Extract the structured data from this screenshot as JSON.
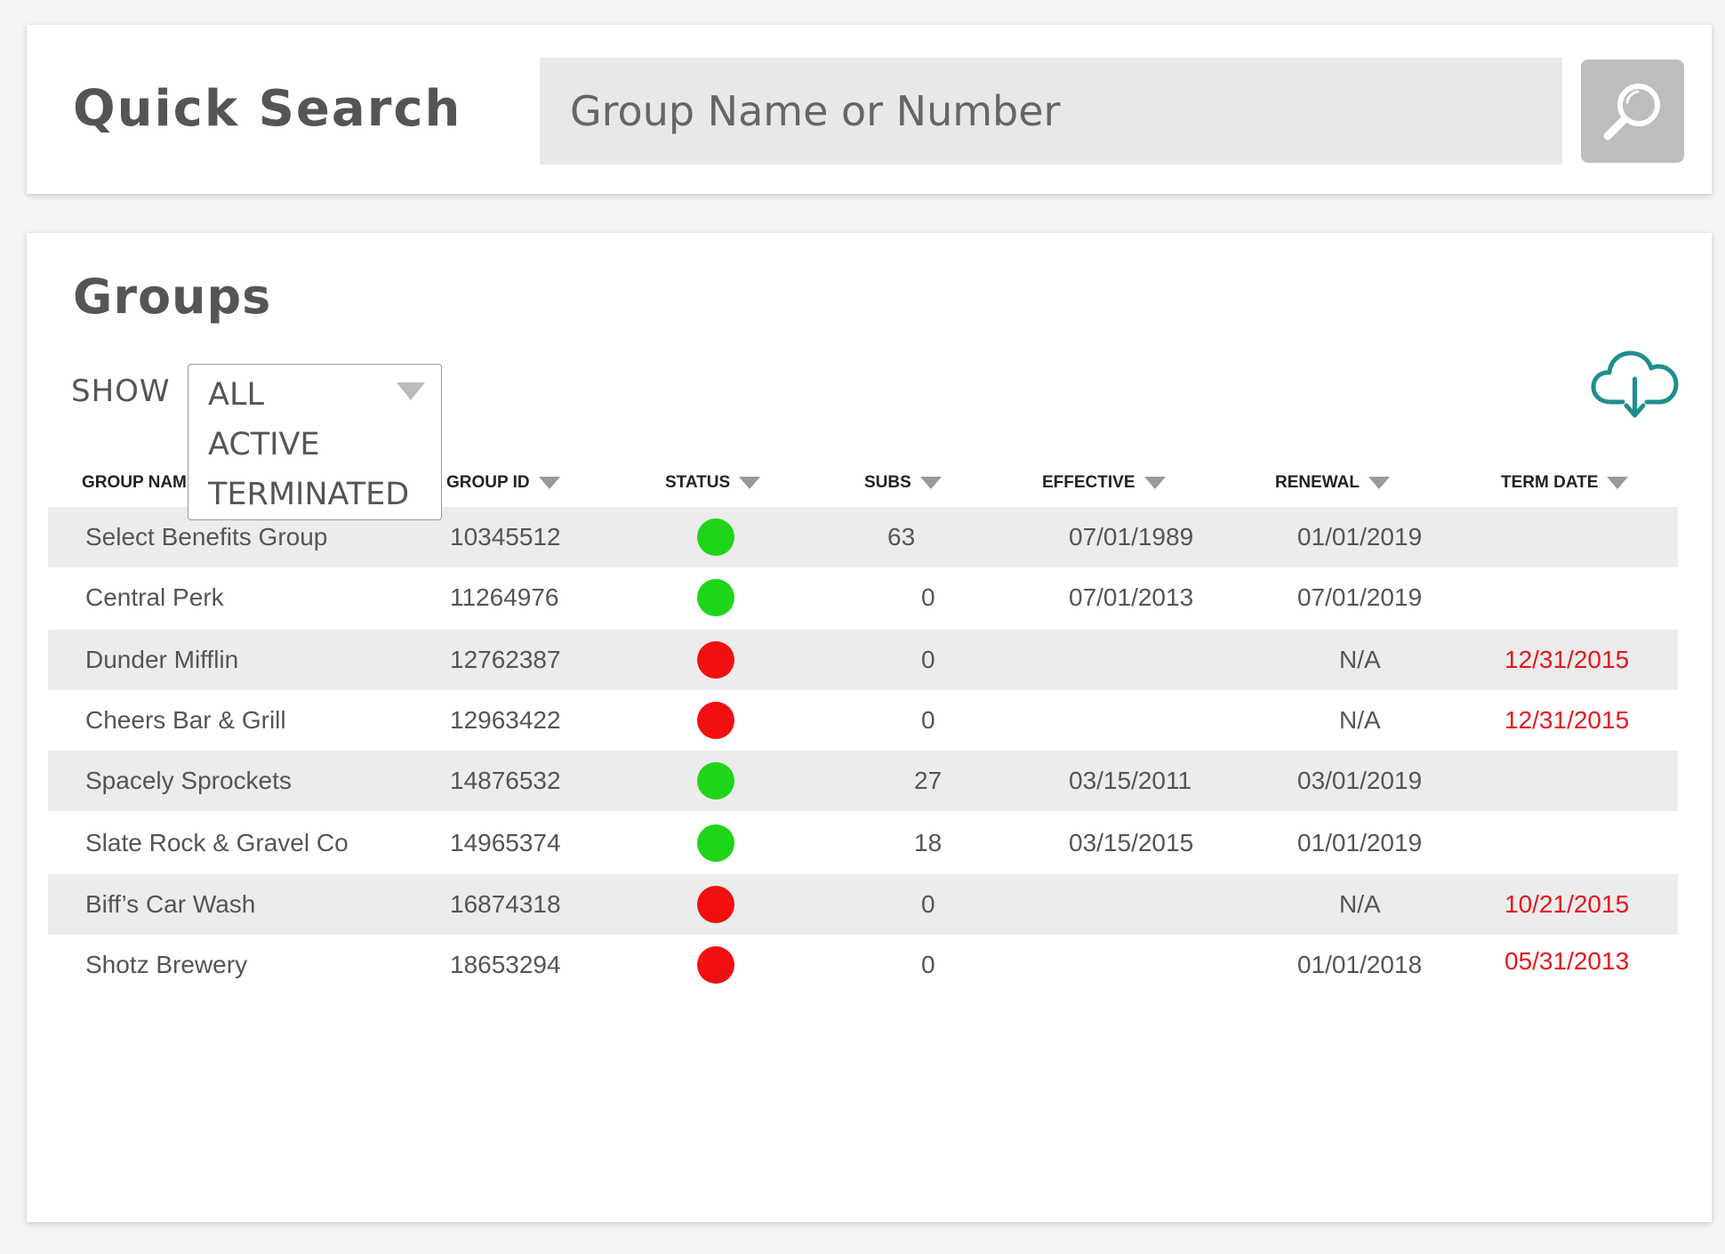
{
  "quick_search": {
    "title": "Quick Search",
    "placeholder": "Group Name or Number",
    "button_icon": "search-icon"
  },
  "groups": {
    "title": "Groups",
    "show_label": "SHOW",
    "filter_options": [
      "ALL",
      "ACTIVE",
      "TERMINATED"
    ],
    "selected_filter": "ALL",
    "download_icon": "cloud-download-icon",
    "columns": [
      "GROUP NAME",
      "GROUP ID",
      "STATUS",
      "SUBS",
      "EFFECTIVE",
      "RENEWAL",
      "TERM DATE"
    ],
    "rows": [
      {
        "name": "Select Benefits Group",
        "id": "10345512",
        "status": "active",
        "subs": "63",
        "effective": "07/01/1989",
        "renewal": "01/01/2019",
        "term_date": ""
      },
      {
        "name": "Central Perk",
        "id": "11264976",
        "status": "active",
        "subs": "0",
        "effective": "07/01/2013",
        "renewal": "07/01/2019",
        "term_date": ""
      },
      {
        "name": "Dunder Mifflin",
        "id": "12762387",
        "status": "terminated",
        "subs": "0",
        "effective": "",
        "renewal": "N/A",
        "term_date": "12/31/2015"
      },
      {
        "name": "Cheers Bar & Grill",
        "id": "12963422",
        "status": "terminated",
        "subs": "0",
        "effective": "",
        "renewal": "N/A",
        "term_date": "12/31/2015"
      },
      {
        "name": "Spacely Sprockets",
        "id": "14876532",
        "status": "active",
        "subs": "27",
        "effective": "03/15/2011",
        "renewal": "03/01/2019",
        "term_date": ""
      },
      {
        "name": "Slate Rock & Gravel Co",
        "id": "14965374",
        "status": "active",
        "subs": "18",
        "effective": "03/15/2015",
        "renewal": "01/01/2019",
        "term_date": ""
      },
      {
        "name": "Biff’s Car Wash",
        "id": "16874318",
        "status": "terminated",
        "subs": "0",
        "effective": "",
        "renewal": "N/A",
        "term_date": "10/21/2015"
      },
      {
        "name": "Shotz Brewery",
        "id": "18653294",
        "status": "terminated",
        "subs": "0",
        "effective": "",
        "renewal": "01/01/2018",
        "term_date": "05/31/2013"
      }
    ]
  },
  "colors": {
    "active": "#1ed51a",
    "terminated": "#f20f0f",
    "term_date_text": "#e8161c",
    "download_icon": "#1f8e8e",
    "row_shade": "#ececec"
  }
}
